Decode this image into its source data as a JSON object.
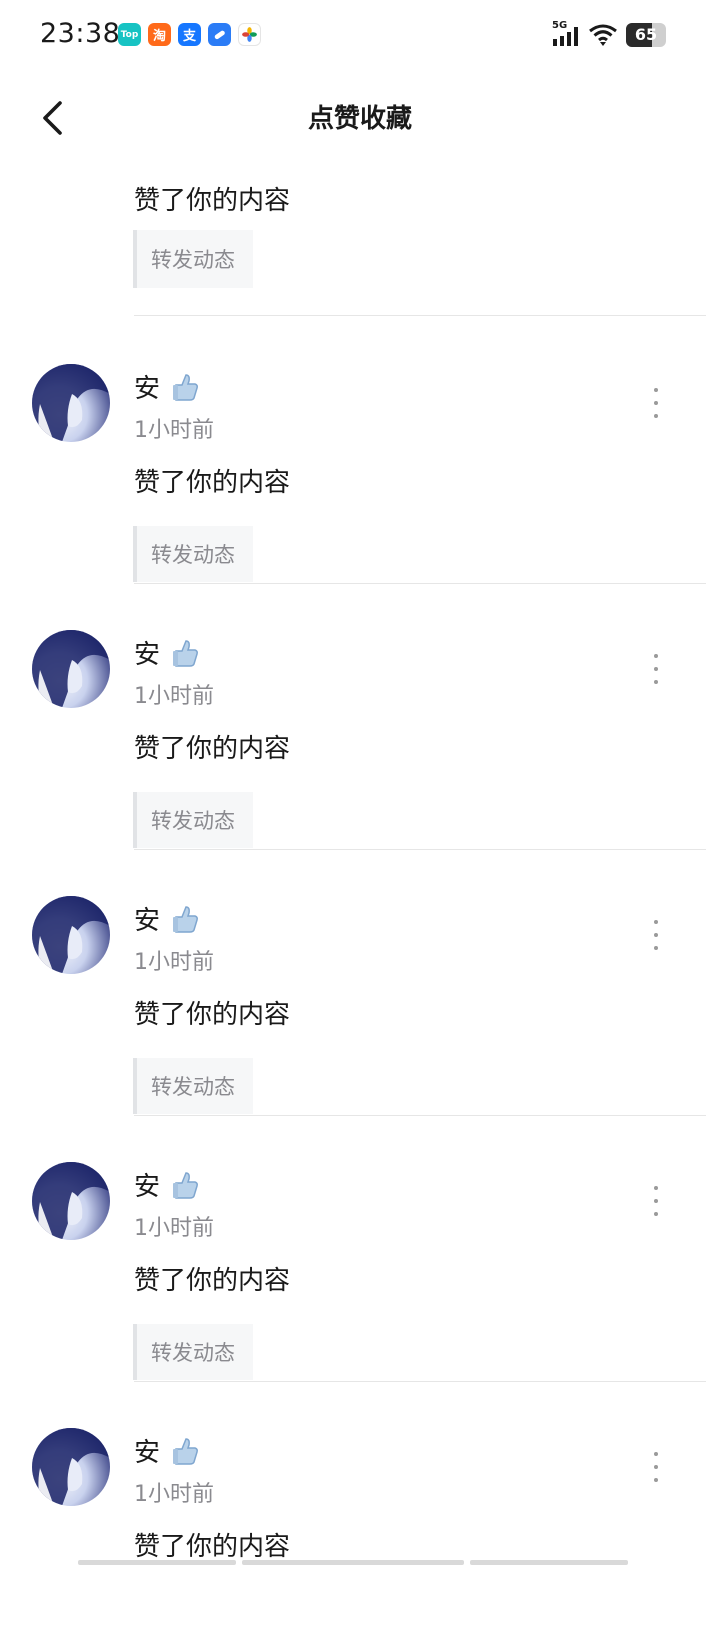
{
  "status_bar": {
    "time": "23:38",
    "apps": [
      {
        "name": "toutiao-top-icon",
        "label": "Top",
        "color": "#17c3c3"
      },
      {
        "name": "taobao-icon",
        "label": "淘",
        "color": "#ff6a1a"
      },
      {
        "name": "alipay-icon",
        "label": "支",
        "color": "#1677ff"
      },
      {
        "name": "browser-icon",
        "label": "",
        "color": "#2b7cf6"
      },
      {
        "name": "photos-icon",
        "label": "",
        "color": "#ffffff"
      }
    ],
    "network": "5G",
    "battery": "65",
    "battery_level": 0.65
  },
  "header": {
    "title": "点赞收藏"
  },
  "feed": {
    "partial_top": {
      "action": "赞了你的内容",
      "quote": "转发动态"
    },
    "items": [
      {
        "user": "安",
        "time": "1小时前",
        "action": "赞了你的内容",
        "quote": "转发动态"
      },
      {
        "user": "安",
        "time": "1小时前",
        "action": "赞了你的内容",
        "quote": "转发动态"
      },
      {
        "user": "安",
        "time": "1小时前",
        "action": "赞了你的内容",
        "quote": "转发动态"
      },
      {
        "user": "安",
        "time": "1小时前",
        "action": "赞了你的内容",
        "quote": "转发动态"
      },
      {
        "user": "安",
        "time": "1小时前",
        "action": "赞了你的内容",
        "quote": ""
      }
    ]
  },
  "colors": {
    "text": "#1a1a1a",
    "muted": "#8a8a8f",
    "quote_bg": "#f6f7f8",
    "divider": "#e6e6e6"
  }
}
